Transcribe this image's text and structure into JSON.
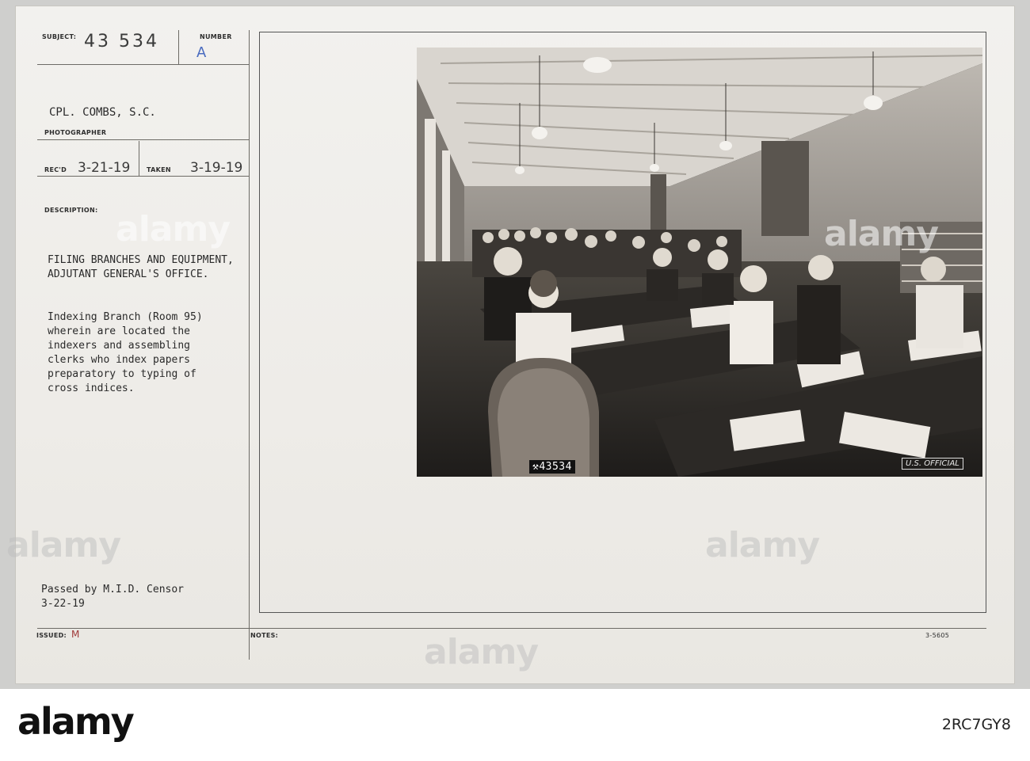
{
  "card": {
    "subject_label": "SUBJECT:",
    "subject_value": "43 534",
    "number_label": "NUMBER",
    "number_value": "A",
    "photographer_name": "CPL. COMBS, S.C.",
    "photographer_label": "PHOTOGRAPHER",
    "recd_label": "REC'D",
    "recd_value": "3-21-19",
    "taken_label": "TAKEN",
    "taken_value": "3-19-19",
    "description_label": "DESCRIPTION:",
    "title_line1": "FILING BRANCHES AND EQUIPMENT,",
    "title_line2": "ADJUTANT GENERAL'S OFFICE.",
    "body_lines": [
      "Indexing Branch (Room 95)",
      "wherein are located the",
      "indexers and assembling",
      "clerks who index papers",
      "preparatory to typing of",
      "cross indices."
    ],
    "censor_line1": "Passed by M.I.D. Censor",
    "censor_line2": "3-22-19",
    "issued_label": "ISSUED:",
    "issued_value": "M",
    "notes_label": "NOTES:",
    "form_code": "3-5605"
  },
  "photo": {
    "negative_stamp": "43534",
    "official_stamp": "U.S. OFFICIAL"
  },
  "watermark": {
    "text": "alamy"
  },
  "footer": {
    "brand": "alamy",
    "image_code": "2RC7GY8"
  }
}
